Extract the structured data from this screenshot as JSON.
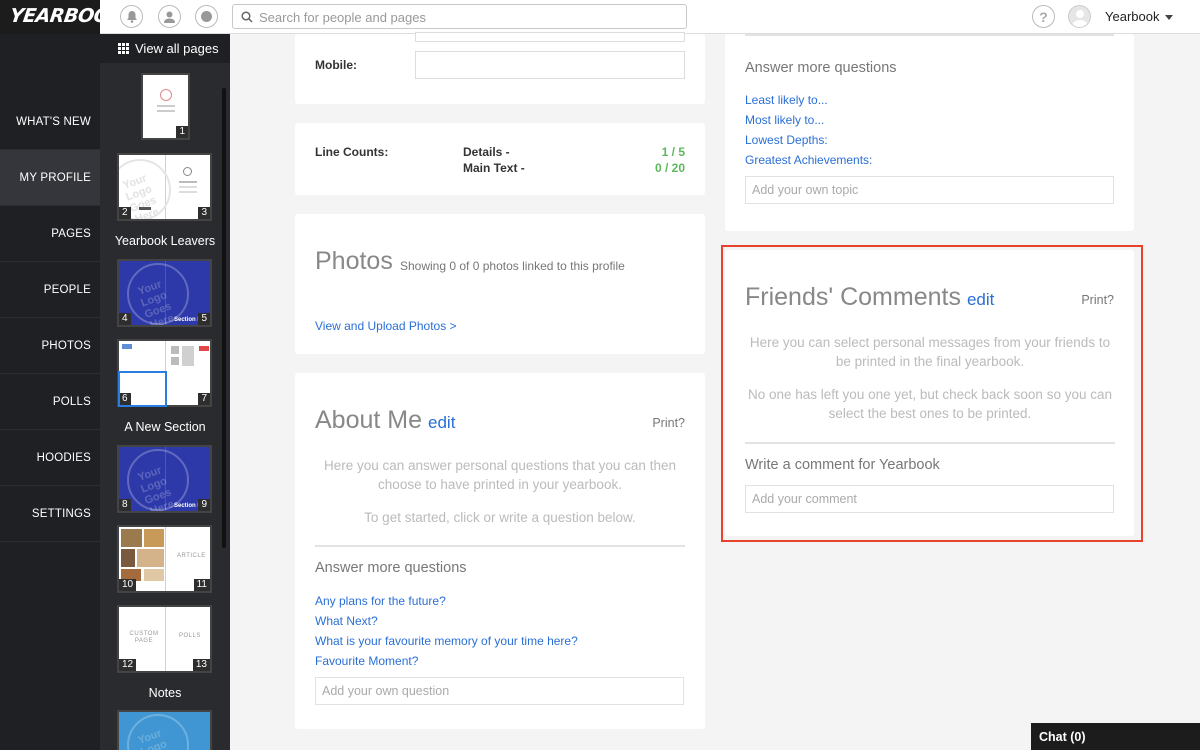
{
  "header": {
    "logo": "YEARBOOK",
    "search_placeholder": "Search for people and pages",
    "help": "?",
    "user_name": "Yearbook"
  },
  "nav": {
    "items": [
      {
        "label": "WHAT'S NEW"
      },
      {
        "label": "MY PROFILE"
      },
      {
        "label": "PAGES"
      },
      {
        "label": "PEOPLE"
      },
      {
        "label": "PHOTOS"
      },
      {
        "label": "POLLS"
      },
      {
        "label": "HOODIES"
      },
      {
        "label": "SETTINGS"
      }
    ]
  },
  "pages": {
    "view_all": "View all pages",
    "sections": [
      "Yearbook Leavers",
      "A New Section",
      "Notes"
    ],
    "logo_placeholder": "Your Logo Goes Here",
    "section_tag": "Section H",
    "article_label": "ARTICLE",
    "custom_page_label": "CUSTOM PAGE",
    "polls_label": "POLLS",
    "page_numbers": [
      "1",
      "2",
      "3",
      "4",
      "5",
      "6",
      "7",
      "8",
      "9",
      "10",
      "11",
      "12",
      "13"
    ]
  },
  "contact": {
    "mobile_label": "Mobile:"
  },
  "line_counts": {
    "label": "Line Counts:",
    "details_label": "Details -",
    "details_value": "1 / 5",
    "main_text_label": "Main Text -",
    "main_text_value": "0 / 20"
  },
  "photos": {
    "title": "Photos",
    "subtitle": "Showing 0 of 0 photos linked to this profile",
    "link": "View and Upload Photos >"
  },
  "about": {
    "title": "About Me",
    "edit": "edit",
    "print": "Print?",
    "hint1": "Here you can answer personal questions that you can then choose to have printed in your yearbook.",
    "hint2": "To get started, click or write a question below.",
    "answer_more": "Answer more questions",
    "questions": [
      "Any plans for the future?",
      "What Next?",
      "What is your favourite memory of your time here?",
      "Favourite Moment?"
    ],
    "add_placeholder": "Add your own question"
  },
  "topics": {
    "answer_more": "Answer more questions",
    "items": [
      "Least likely to...",
      "Most likely to...",
      "Lowest Depths:",
      "Greatest Achievements:"
    ],
    "add_placeholder": "Add your own topic"
  },
  "friends": {
    "title": "Friends' Comments",
    "edit": "edit",
    "print": "Print?",
    "hint1": "Here you can select personal messages from your friends to be printed in the final yearbook.",
    "hint2": "No one has left you one yet, but check back soon so you can select the best ones to be printed.",
    "write_label": "Write a comment for Yearbook",
    "comment_placeholder": "Add your comment"
  },
  "chat": {
    "label": "Chat (0)"
  },
  "colors": {
    "accent": "#2a6fd6",
    "highlight": "#e8412c",
    "count_green": "#5cb85c",
    "nav_bg": "#1f2024"
  }
}
